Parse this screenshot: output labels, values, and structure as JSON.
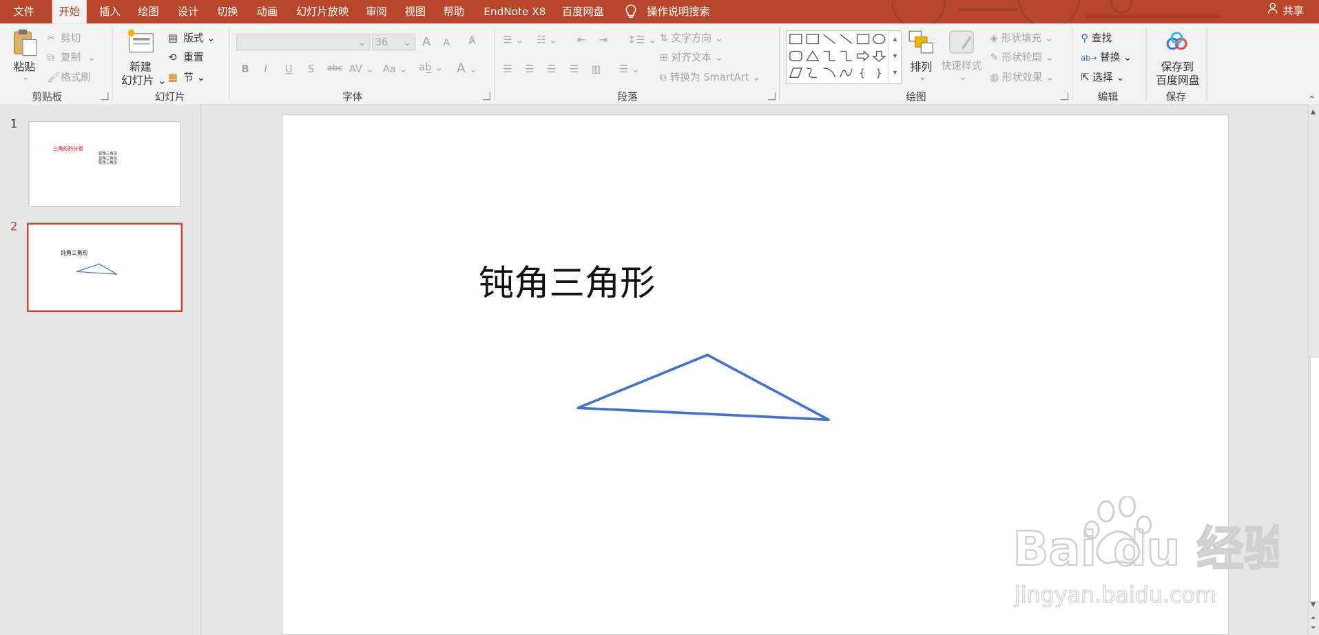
{
  "tabs": [
    "文件",
    "开始",
    "插入",
    "绘图",
    "设计",
    "切换",
    "动画",
    "幻灯片放映",
    "审阅",
    "视图",
    "帮助",
    "EndNote X8",
    "百度网盘"
  ],
  "active_tab": "开始",
  "tell_me": "操作说明搜索",
  "share": "共享",
  "clipboard": {
    "paste": "粘贴",
    "cut": "剪切",
    "copy": "复制",
    "format_painter": "格式刷",
    "label": "剪贴板"
  },
  "slides_group": {
    "new_slide_line1": "新建",
    "new_slide_line2": "幻灯片",
    "layout": "版式",
    "reset": "重置",
    "section": "节",
    "label": "幻灯片"
  },
  "font": {
    "font_size": "36",
    "label": "字体",
    "grow": "A",
    "shrink": "A",
    "bold": "B",
    "italic": "I",
    "underline": "U",
    "shadow": "S",
    "strike": "abc",
    "spacing": "AV",
    "case": "Aa",
    "color": "A"
  },
  "paragraph": {
    "text_direction": "文字方向",
    "align_text": "对齐文本",
    "smartart": "转换为 SmartArt",
    "label": "段落"
  },
  "drawing": {
    "arrange": "排列",
    "quick_styles": "快速样式",
    "shape_fill": "形状填充",
    "shape_outline": "形状轮廓",
    "shape_effects": "形状效果",
    "label": "绘图"
  },
  "editing": {
    "find": "查找",
    "replace": "替换",
    "select": "选择",
    "label": "编辑"
  },
  "save": {
    "line1": "保存到",
    "line2": "百度网盘",
    "label": "保存"
  },
  "thumbnails": [
    {
      "number": "1",
      "title": "三角形的分类",
      "lines": [
        "锐角三角形",
        "直角三角形",
        "钝角三角形"
      ]
    },
    {
      "number": "2",
      "title": "钝角三角形"
    }
  ],
  "slide": {
    "title": "钝角三角形"
  },
  "colors": {
    "accent": "#b7472a",
    "triangle": "#4472c4",
    "thumb_title_red": "#ff0000"
  },
  "watermark": {
    "brand": "Bai  du 经验",
    "url": "jingyan.baidu.com"
  }
}
